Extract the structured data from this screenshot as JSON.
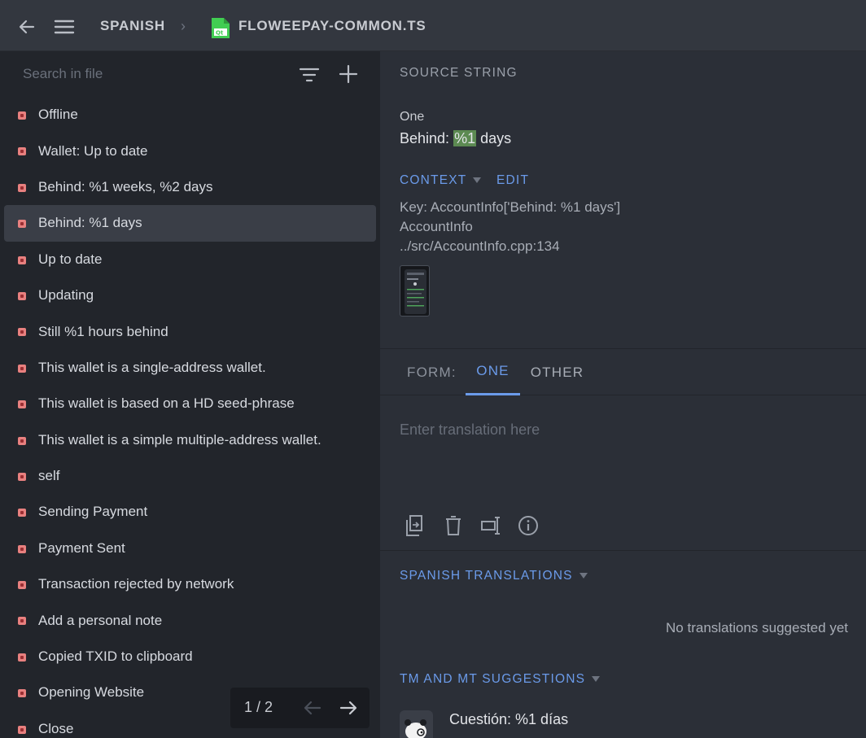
{
  "header": {
    "project": "SPANISH",
    "file": "FLOWEEPAY-COMMON.TS",
    "back_icon": "arrow-left-icon",
    "menu_icon": "hamburger-icon",
    "file_icon": "qt-file-icon"
  },
  "sidebar": {
    "search_placeholder": "Search in file",
    "strings": [
      {
        "text": "Offline",
        "selected": false
      },
      {
        "text": "Wallet: Up to date",
        "selected": false
      },
      {
        "text": "Behind: %1 weeks, %2 days",
        "selected": false
      },
      {
        "text": "Behind: %1 days",
        "selected": true
      },
      {
        "text": "Up to date",
        "selected": false
      },
      {
        "text": "Updating",
        "selected": false
      },
      {
        "text": "Still %1 hours behind",
        "selected": false
      },
      {
        "text": "This wallet is a single-address wallet.",
        "selected": false
      },
      {
        "text": "This wallet is based on a HD seed-phrase",
        "selected": false
      },
      {
        "text": "This wallet is a simple multiple-address wallet.",
        "selected": false
      },
      {
        "text": "self",
        "selected": false
      },
      {
        "text": "Sending Payment",
        "selected": false
      },
      {
        "text": "Payment Sent",
        "selected": false
      },
      {
        "text": "Transaction rejected by network",
        "selected": false
      },
      {
        "text": "Add a personal note",
        "selected": false
      },
      {
        "text": "Copied TXID to clipboard",
        "selected": false
      },
      {
        "text": "Opening Website",
        "selected": false
      },
      {
        "text": "Close",
        "selected": false
      }
    ],
    "pager": "1 / 2"
  },
  "main": {
    "source_label": "SOURCE STRING",
    "plural_label": "One",
    "source_prefix": "Behind: ",
    "source_highlight": "%1",
    "source_suffix": " days",
    "context_label": "CONTEXT",
    "edit_label": "EDIT",
    "context_lines": [
      "Key: AccountInfo['Behind: %1 days']",
      "AccountInfo",
      "../src/AccountInfo.cpp:134"
    ],
    "form_label": "FORM:",
    "tabs": [
      "ONE",
      "OTHER"
    ],
    "translation_placeholder": "Enter translation here",
    "tools": [
      "copy-source-icon",
      "delete-icon",
      "rtl-icon",
      "info-icon"
    ],
    "translations_label": "SPANISH TRANSLATIONS",
    "no_translations": "No translations suggested yet",
    "tm_label": "TM AND MT SUGGESTIONS",
    "suggestion": "Cuestión: %1 días"
  },
  "colors": {
    "accent": "#6b9bea",
    "untranslated_dot": "#e8807f",
    "highlight": "#5c8a52"
  }
}
